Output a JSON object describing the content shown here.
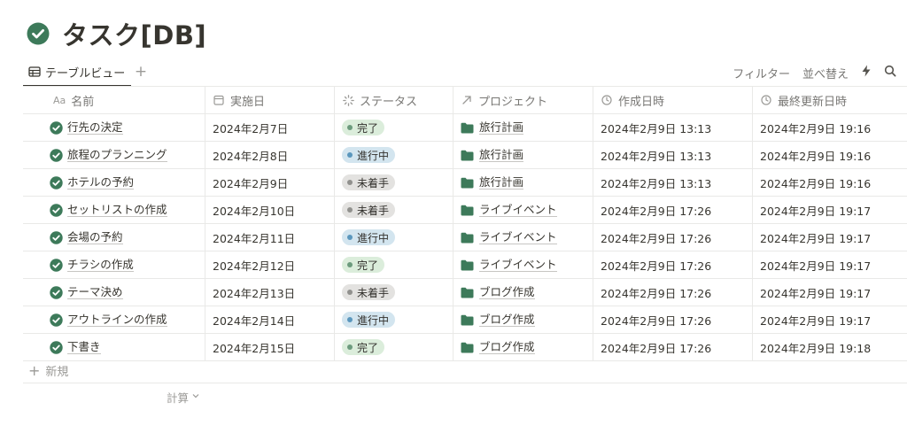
{
  "page": {
    "title": "タスク[DB]",
    "title_icon": "check-circle-icon",
    "accent": "#3d7a5a"
  },
  "view": {
    "tab_label": "テーブルビュー",
    "tab_icon": "table-icon",
    "add_view_icon": "plus-icon",
    "tools": {
      "filter": "フィルター",
      "sort": "並べ替え",
      "automation_icon": "lightning-icon",
      "search_icon": "search-icon"
    }
  },
  "columns": [
    {
      "label": "名前",
      "icon": "text-aa-icon",
      "icon_text": "Aa"
    },
    {
      "label": "実施日",
      "icon": "calendar-icon"
    },
    {
      "label": "ステータス",
      "icon": "status-icon"
    },
    {
      "label": "プロジェクト",
      "icon": "relation-arrow-icon"
    },
    {
      "label": "作成日時",
      "icon": "clock-icon"
    },
    {
      "label": "最終更新日時",
      "icon": "clock-icon"
    }
  ],
  "rows": [
    {
      "name": "行先の決定",
      "date": "2024年2月7日",
      "status": "完了",
      "status_key": "done",
      "project": "旅行計画",
      "created": "2024年2月9日 13:13",
      "updated": "2024年2月9日 19:16"
    },
    {
      "name": "旅程のプランニング",
      "date": "2024年2月8日",
      "status": "進行中",
      "status_key": "prog",
      "project": "旅行計画",
      "created": "2024年2月9日 13:13",
      "updated": "2024年2月9日 19:16"
    },
    {
      "name": "ホテルの予約",
      "date": "2024年2月9日",
      "status": "未着手",
      "status_key": "todo",
      "project": "旅行計画",
      "created": "2024年2月9日 13:13",
      "updated": "2024年2月9日 19:16"
    },
    {
      "name": "セットリストの作成",
      "date": "2024年2月10日",
      "status": "未着手",
      "status_key": "todo",
      "project": "ライブイベント",
      "created": "2024年2月9日 17:26",
      "updated": "2024年2月9日 19:17"
    },
    {
      "name": "会場の予約",
      "date": "2024年2月11日",
      "status": "進行中",
      "status_key": "prog",
      "project": "ライブイベント",
      "created": "2024年2月9日 17:26",
      "updated": "2024年2月9日 19:17"
    },
    {
      "name": "チラシの作成",
      "date": "2024年2月12日",
      "status": "完了",
      "status_key": "done",
      "project": "ライブイベント",
      "created": "2024年2月9日 17:26",
      "updated": "2024年2月9日 19:17"
    },
    {
      "name": "テーマ決め",
      "date": "2024年2月13日",
      "status": "未着手",
      "status_key": "todo",
      "project": "ブログ作成",
      "created": "2024年2月9日 17:26",
      "updated": "2024年2月9日 19:17"
    },
    {
      "name": "アウトラインの作成",
      "date": "2024年2月14日",
      "status": "進行中",
      "status_key": "prog",
      "project": "ブログ作成",
      "created": "2024年2月9日 17:26",
      "updated": "2024年2月9日 19:17"
    },
    {
      "name": "下書き",
      "date": "2024年2月15日",
      "status": "完了",
      "status_key": "done",
      "project": "ブログ作成",
      "created": "2024年2月9日 17:26",
      "updated": "2024年2月9日 19:18"
    }
  ],
  "footer": {
    "new_label": "新規",
    "calc_label": "計算"
  }
}
